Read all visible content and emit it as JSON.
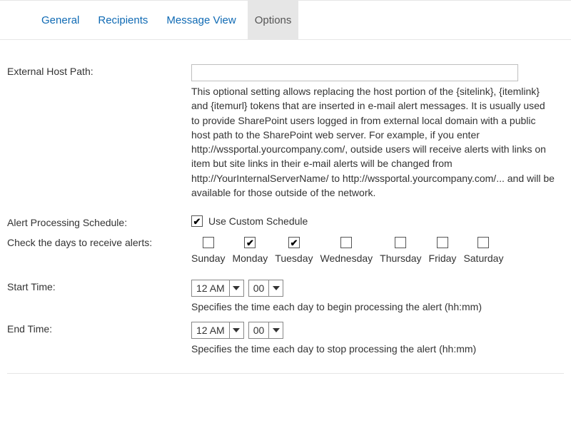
{
  "tabs": {
    "general": "General",
    "recipients": "Recipients",
    "messageView": "Message View",
    "options": "Options"
  },
  "labels": {
    "externalHostPath": "External Host Path:",
    "alertSchedule": "Alert Processing Schedule:",
    "checkDays": "Check the days to receive alerts:",
    "startTime": "Start Time:",
    "endTime": "End Time:"
  },
  "externalHostPath": {
    "value": "",
    "help": "This optional setting allows replacing the host portion of the {sitelink}, {itemlink} and {itemurl} tokens that are inserted in e-mail alert messages. It is usually used to provide SharePoint users logged in from external local domain with a public host path to the SharePoint web server. For example, if you enter http://wssportal.yourcompany.com/, outside users will receive alerts with links on item but site links in their e-mail alerts will be changed from http://YourInternalServerName/ to http://wssportal.yourcompany.com/... and will be available for those outside of the network."
  },
  "schedule": {
    "useCustomLabel": "Use Custom Schedule",
    "useCustom": true,
    "days": [
      {
        "name": "Sunday",
        "checked": false
      },
      {
        "name": "Monday",
        "checked": true
      },
      {
        "name": "Tuesday",
        "checked": true
      },
      {
        "name": "Wednesday",
        "checked": false
      },
      {
        "name": "Thursday",
        "checked": false
      },
      {
        "name": "Friday",
        "checked": false
      },
      {
        "name": "Saturday",
        "checked": false
      }
    ]
  },
  "startTime": {
    "hour": "12 AM",
    "minute": "00",
    "help": "Specifies the time each day to begin processing the alert (hh:mm)"
  },
  "endTime": {
    "hour": "12 AM",
    "minute": "00",
    "help": "Specifies the time each day to stop processing the alert (hh:mm)"
  }
}
